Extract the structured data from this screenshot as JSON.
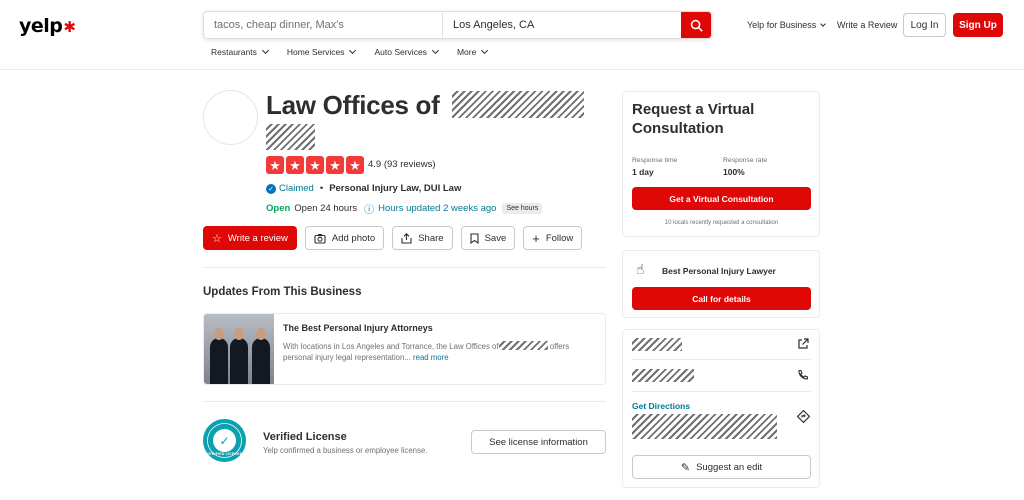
{
  "header": {
    "logo": "yelp",
    "search_placeholder": "tacos, cheap dinner, Max's",
    "location_value": "Los Angeles, CA",
    "yelp_for_business": "Yelp for Business",
    "write_review": "Write a Review",
    "log_in": "Log In",
    "sign_up": "Sign Up",
    "categories": [
      "Restaurants",
      "Home Services",
      "Auto Services",
      "More"
    ]
  },
  "business": {
    "name": "Law Offices of",
    "rating": "4.9 (93 reviews)",
    "stars": 5,
    "claimed": "Claimed",
    "categories": "Personal Injury Law, DUI Law",
    "open_status": "Open",
    "hours": "Open 24 hours",
    "hours_updated": "Hours updated 2 weeks ago",
    "see_hours": "See hours"
  },
  "actions": {
    "write_review": "Write a review",
    "add_photo": "Add photo",
    "share": "Share",
    "save": "Save",
    "follow": "Follow"
  },
  "updates": {
    "section_title": "Updates From This Business",
    "title": "The Best Personal Injury Attorneys",
    "body_before": "With locations in Los Angeles and Torrance, the Law Offices of",
    "body_after": "offers personal injury legal representation...",
    "read_more": "read more"
  },
  "verified": {
    "badge_text": "VERIFIED LICENSE",
    "title": "Verified License",
    "subtitle": "Yelp confirmed a business or employee license.",
    "button": "See license information"
  },
  "consultation": {
    "title": "Request a Virtual Consultation",
    "response_time_label": "Response time",
    "response_time_value": "1 day",
    "response_rate_label": "Response rate",
    "response_rate_value": "100%",
    "button": "Get a Virtual Consultation",
    "note": "10 locals recently requested a consultation"
  },
  "promo": {
    "title": "Best Personal Injury Lawyer",
    "button": "Call for details"
  },
  "contact": {
    "get_directions": "Get Directions",
    "suggest_edit": "Suggest an edit"
  },
  "colors": {
    "brand_red": "#e00707",
    "link_teal": "#027a97",
    "open_green": "#04a65f",
    "verified_teal": "#0aa1b0"
  }
}
